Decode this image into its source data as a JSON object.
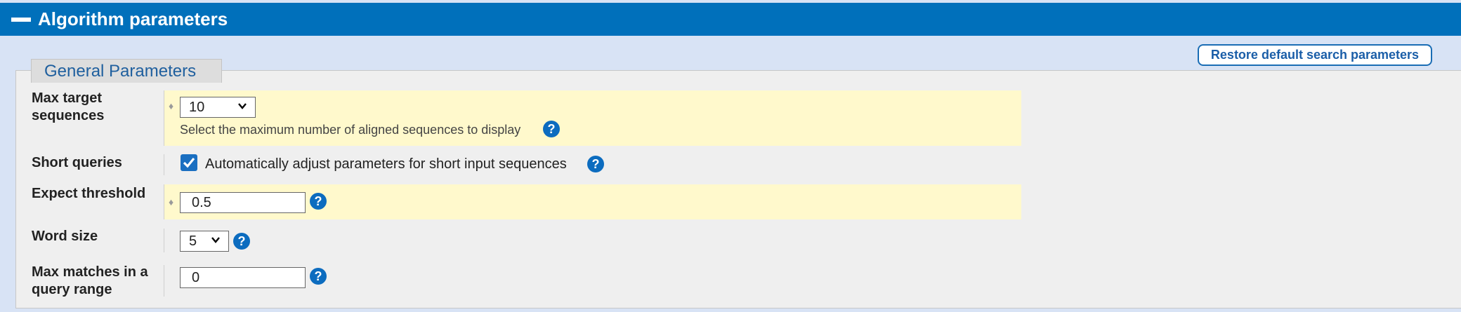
{
  "header": {
    "title": "Algorithm parameters"
  },
  "restore_button": {
    "label": "Restore default search parameters"
  },
  "general": {
    "legend": "General Parameters"
  },
  "max_target": {
    "label_line1": "Max target",
    "label_line2": "sequences",
    "value": "10",
    "hint": "Select the maximum number of aligned sequences to display"
  },
  "short_queries": {
    "label": "Short queries",
    "checked": true,
    "option_label": "Automatically adjust parameters for short input sequences"
  },
  "expect_threshold": {
    "label": "Expect threshold",
    "value": "0.5"
  },
  "word_size": {
    "label": "Word size",
    "value": "5"
  },
  "max_matches": {
    "label_line1": "Max matches in a",
    "label_line2": "query range",
    "value": "0"
  },
  "icons": {
    "help": "?",
    "diamond": "♦"
  },
  "colors": {
    "header": "#0070bb",
    "highlight": "#fff9cc",
    "accent": "#1a6db5",
    "help": "#0c6cbf"
  }
}
